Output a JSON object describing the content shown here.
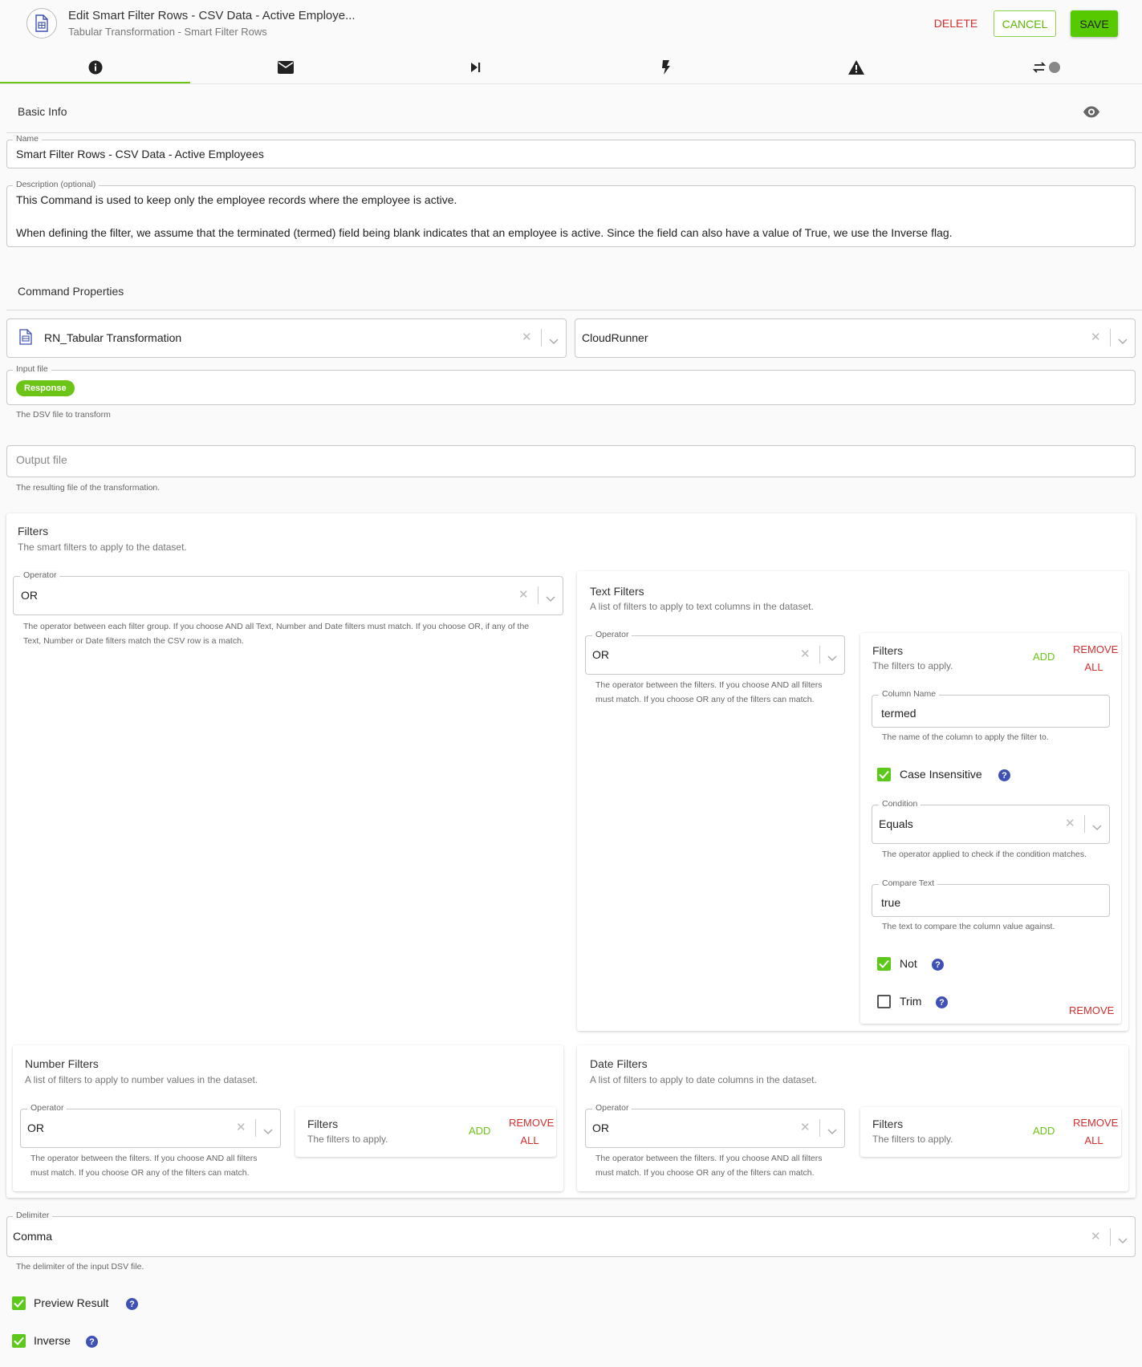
{
  "header": {
    "title": "Edit Smart Filter Rows - CSV Data - Active Employe...",
    "subtitle": "Tabular Transformation - Smart Filter Rows",
    "delete_label": "DELETE",
    "cancel_label": "CANCEL",
    "save_label": "SAVE"
  },
  "tabs": [
    {
      "icon": "info-icon",
      "active": true
    },
    {
      "icon": "mail-icon"
    },
    {
      "icon": "skip-next-icon"
    },
    {
      "icon": "flash-icon"
    },
    {
      "icon": "warning-icon"
    },
    {
      "icon": "repeat-toggle-icon"
    }
  ],
  "basic_info": {
    "title": "Basic Info",
    "name_label": "Name",
    "name_value": "Smart Filter Rows - CSV Data - Active Employees",
    "description_label": "Description (optional)",
    "description_line1": "This Command is used to keep only the employee records where the employee is active.",
    "description_line2": "When defining the filter, we assume that the terminated (termed) field being blank indicates that an employee is active.  Since the field can also have a value of True, we use the Inverse flag."
  },
  "command_properties": {
    "title": "Command Properties",
    "command_value": "RN_Tabular Transformation",
    "runner_value": "CloudRunner",
    "input_label": "Input file",
    "input_chip": "Response",
    "input_helper": "The DSV file to transform",
    "output_placeholder": "Output file",
    "output_helper": "The resulting file of the transformation."
  },
  "filters": {
    "title": "Filters",
    "subtitle": "The smart filters to apply to the dataset.",
    "operator_label": "Operator",
    "operator_value": "OR",
    "operator_helper_line1": "The operator between each filter group. If you choose AND all Text, Number and Date filters must match. If you choose OR, if any of the",
    "operator_helper_line2": "Text, Number or Date filters match the CSV row is a match."
  },
  "text_filters": {
    "title": "Text Filters",
    "subtitle": "A list of filters to apply to text columns in the dataset.",
    "operator_label": "Operator",
    "operator_value": "OR",
    "operator_helper_line1": "The operator between the filters. If you choose AND all filters",
    "operator_helper_line2": "must match. If you choose OR any of the filters can match.",
    "inner": {
      "title": "Filters",
      "subtitle": "The filters to apply.",
      "add_label": "ADD",
      "remove_all_line1": "REMOVE",
      "remove_all_line2": "ALL",
      "column_label": "Column Name",
      "column_value": "termed",
      "column_helper": "The name of the column to apply the filter to.",
      "case_label": "Case Insensitive",
      "condition_label": "Condition",
      "condition_value": "Equals",
      "condition_helper": "The operator applied to check if the condition matches.",
      "compare_label": "Compare Text",
      "compare_value": "true",
      "compare_helper": "The text to compare the column value against.",
      "not_label": "Not",
      "trim_label": "Trim",
      "remove_label": "REMOVE"
    }
  },
  "number_filters": {
    "title": "Number Filters",
    "subtitle": "A list of filters to apply to number values in the dataset.",
    "operator_label": "Operator",
    "operator_value": "OR",
    "operator_helper_line1": "The operator between the filters. If you choose AND all filters",
    "operator_helper_line2": "must match. If you choose OR any of the filters can match.",
    "inner": {
      "title": "Filters",
      "subtitle": "The filters to apply.",
      "add_label": "ADD",
      "remove_all_line1": "REMOVE",
      "remove_all_line2": "ALL"
    }
  },
  "date_filters": {
    "title": "Date Filters",
    "subtitle": "A list of filters to apply to date columns in the dataset.",
    "operator_label": "Operator",
    "operator_value": "OR",
    "operator_helper_line1": "The operator between the filters. If you choose AND all filters",
    "operator_helper_line2": "must match. If you choose OR any of the filters can match.",
    "inner": {
      "title": "Filters",
      "subtitle": "The filters to apply.",
      "add_label": "ADD",
      "remove_all_line1": "REMOVE",
      "remove_all_line2": "ALL"
    }
  },
  "delimiter": {
    "label": "Delimiter",
    "value": "Comma",
    "helper": "The delimiter of the input DSV file."
  },
  "options": {
    "preview_label": "Preview Result",
    "inverse_label": "Inverse"
  },
  "colors": {
    "accent": "#6cc417",
    "danger": "#d32f2f",
    "help": "#3f51b5"
  }
}
